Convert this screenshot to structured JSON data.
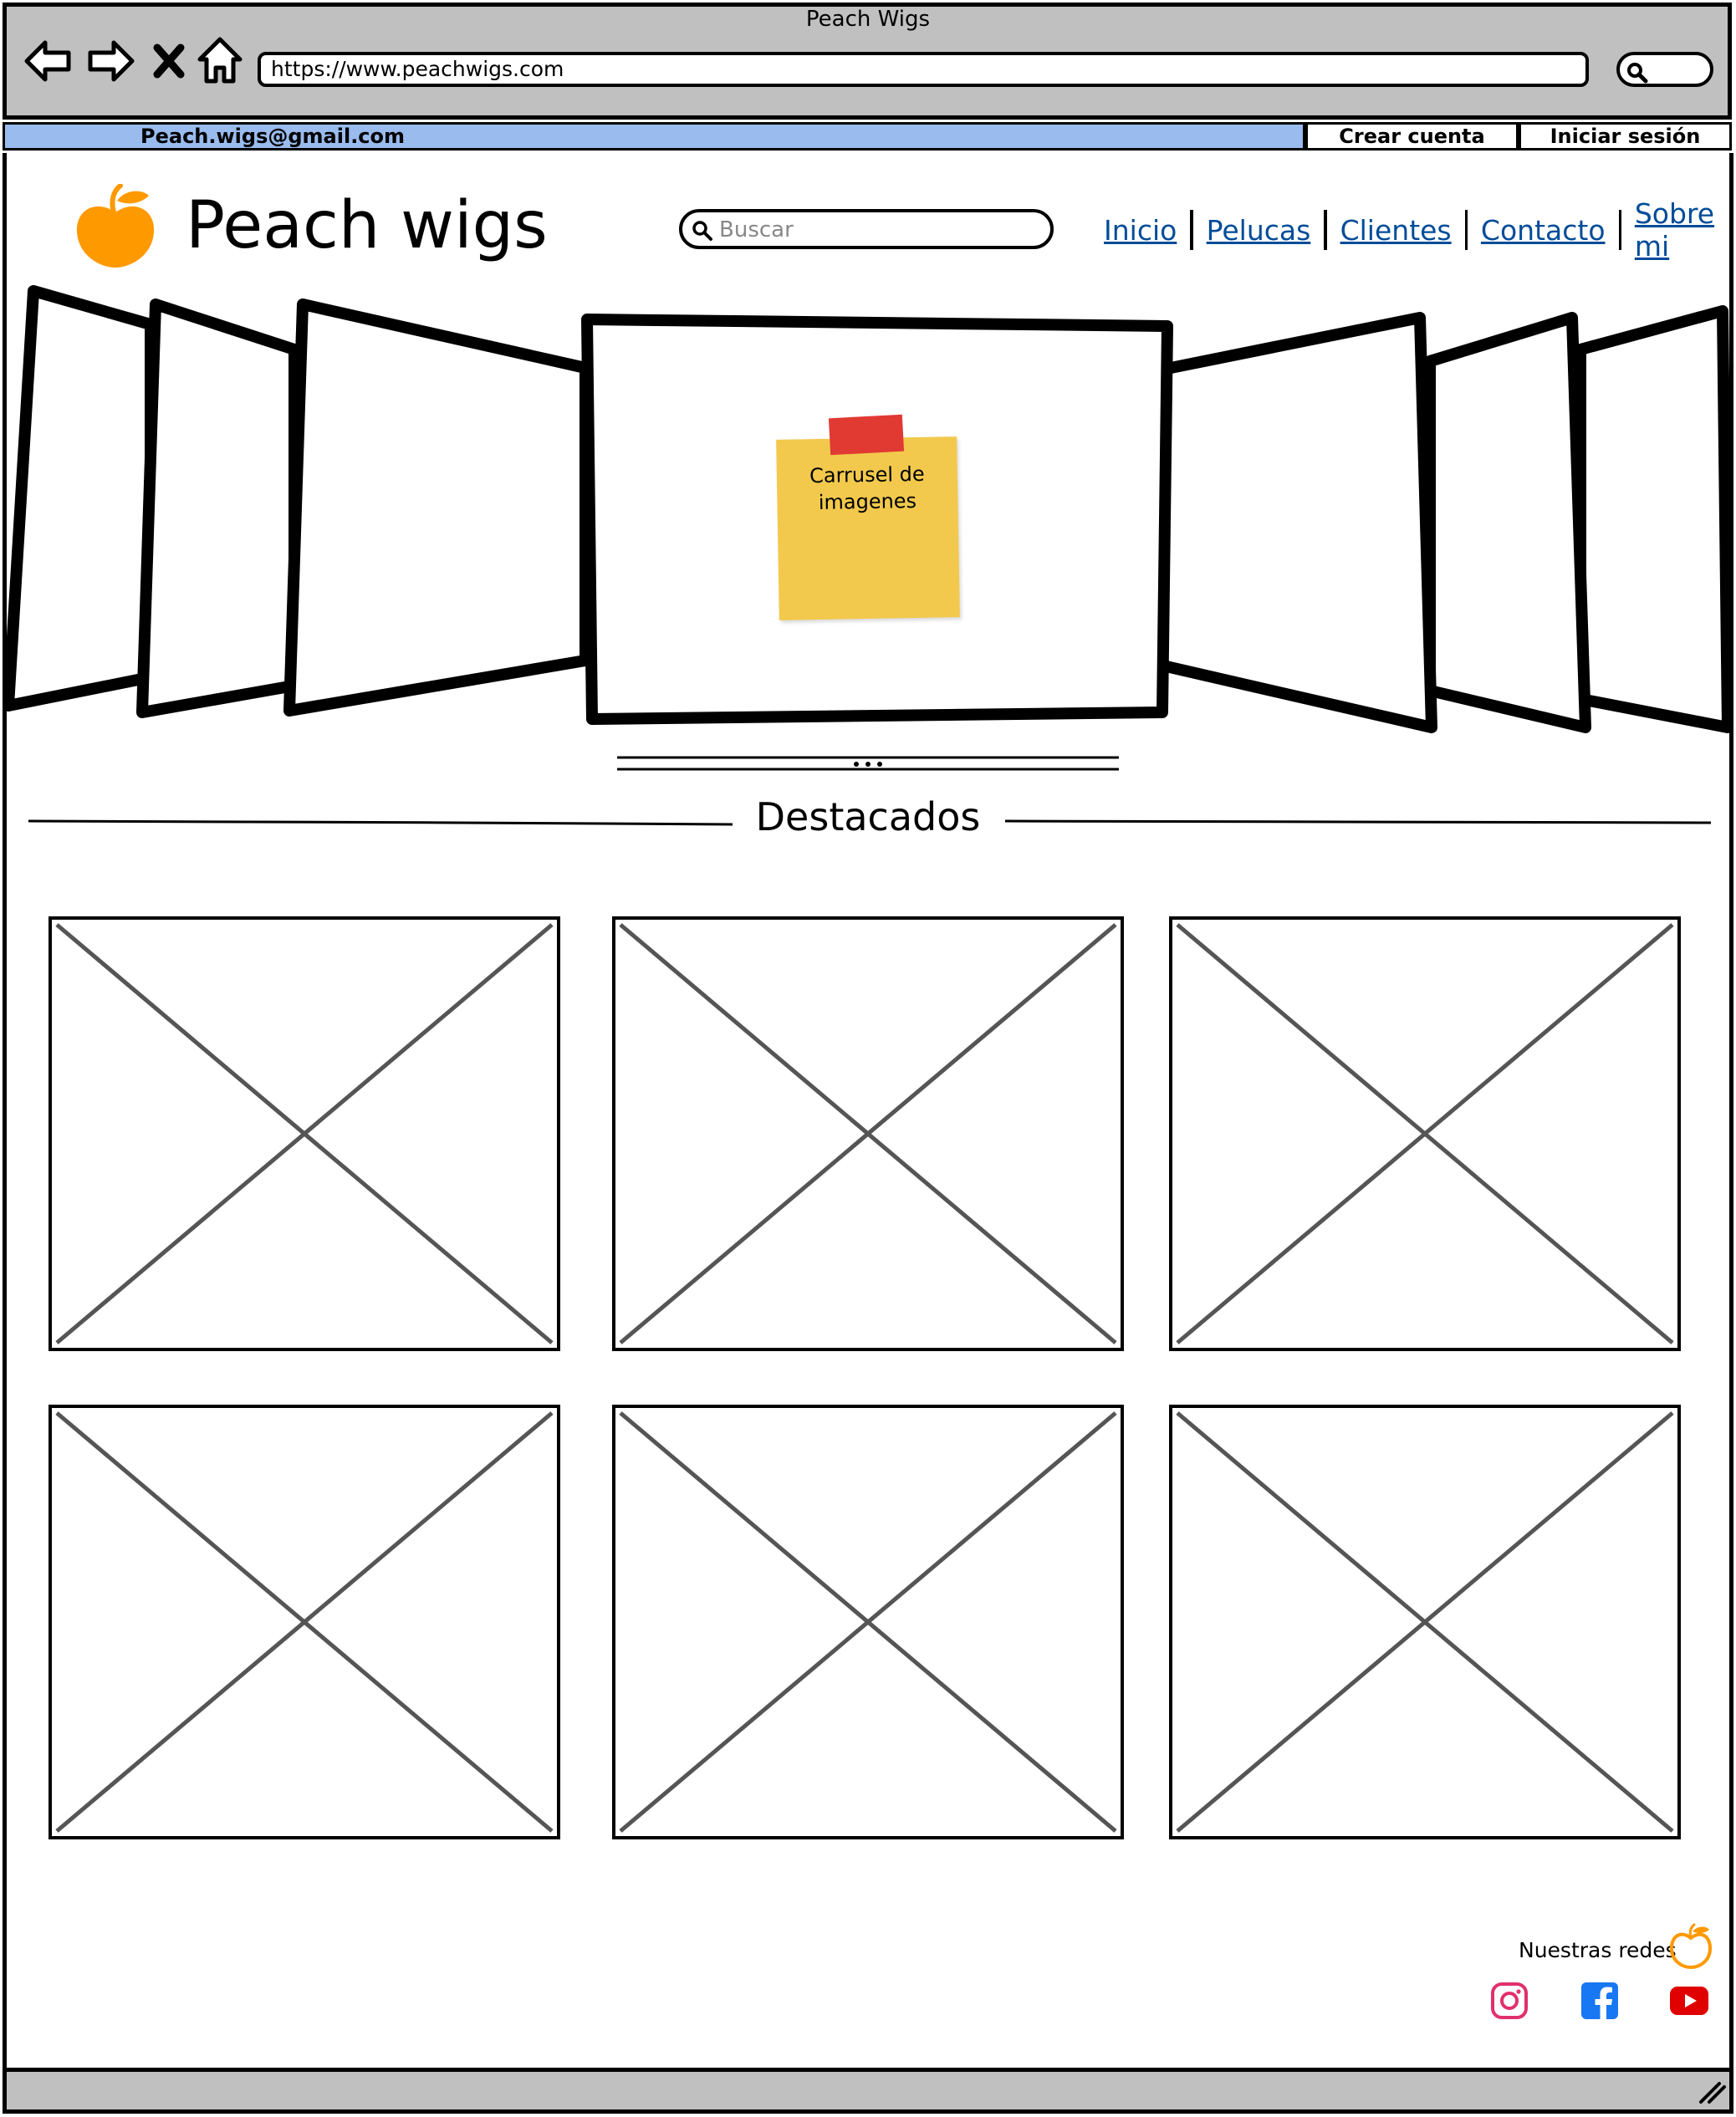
{
  "window": {
    "title": "Peach Wigs"
  },
  "toolbar": {
    "back_icon": "back-arrow-icon",
    "forward_icon": "forward-arrow-icon",
    "stop_icon": "close-icon",
    "home_icon": "home-icon",
    "url": "https://www.peachwigs.com",
    "search_icon": "search-icon"
  },
  "topbar": {
    "email": "Peach.wigs@gmail.com",
    "create_account": "Crear cuenta",
    "login": "Iniciar sesión",
    "accent_color": "#99bbee"
  },
  "header": {
    "logo_icon": "peach-icon",
    "brand": "Peach wigs",
    "search_placeholder": "Buscar",
    "nav": [
      "Inicio",
      "Pelucas",
      "Clientes",
      "Contacto",
      "Sobre mi"
    ],
    "link_color": "#004c99"
  },
  "carousel": {
    "note": "Carrusel de imagenes",
    "note_color": "#f2c94c",
    "tape_color": "#e03a33"
  },
  "featured": {
    "title": "Destacados",
    "items": [
      "image-placeholder",
      "image-placeholder",
      "image-placeholder",
      "image-placeholder",
      "image-placeholder",
      "image-placeholder"
    ]
  },
  "footer": {
    "social_label": "Nuestras redes",
    "social": [
      "instagram-icon",
      "facebook-icon",
      "youtube-icon"
    ]
  }
}
